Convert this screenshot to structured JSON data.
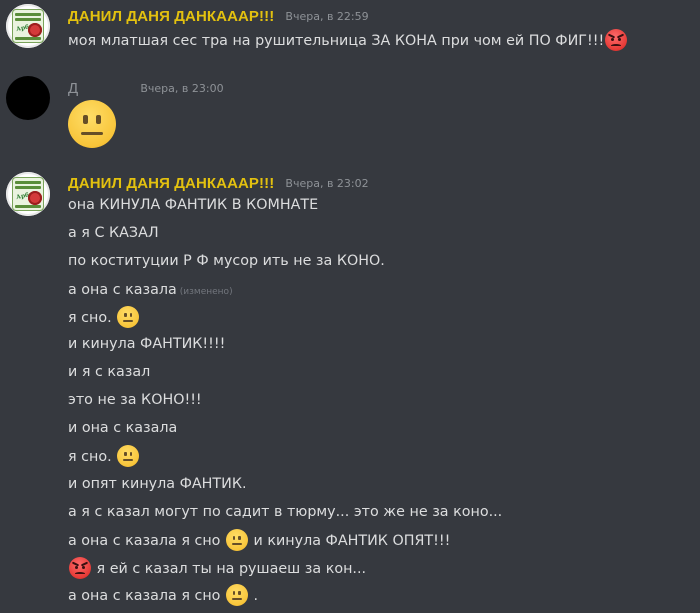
{
  "messages": [
    {
      "author": "ДАНИЛ ДАНЯ ДАНКАААР!!!",
      "timestamp": "Вчера, в 22:59",
      "avatar_text": "Арбуз",
      "lines": [
        {
          "text": "моя млатшая сес тра на рушительница ЗА КОНА при чом ей ПО ФИГ!!!",
          "emoji_after": "angry-face-icon"
        }
      ]
    },
    {
      "author": "Д",
      "timestamp": "Вчера, в 23:00",
      "big_emoji": "neutral-face-icon"
    },
    {
      "author": "ДАНИЛ ДАНЯ ДАНКАААР!!!",
      "timestamp": "Вчера, в 23:02",
      "lines": [
        {
          "text": "она КИНУЛА ФАНТИК В КОМНАТЕ"
        },
        {
          "text": "а я С КАЗАЛ"
        },
        {
          "text": "по коституции Р Ф мусор ить не за КОНО."
        },
        {
          "text": "а она с казала",
          "edited": "(изменено)"
        },
        {
          "text": "я сно.",
          "emoji_after": "neutral-face-icon"
        },
        {
          "text": "и кинула ФАНТИК!!!!"
        },
        {
          "text": "и я с казал"
        },
        {
          "text": "это не за КОНО!!!"
        },
        {
          "text": "и она с казала"
        },
        {
          "text": "я сно.",
          "emoji_after": "neutral-face-icon"
        },
        {
          "text": "и опят кинула ФАНТИК."
        },
        {
          "text": "а я с казал могут по садит в тюрму... это же не за коно..."
        },
        {
          "text": "а она с казала я сно",
          "emoji_after": "neutral-face-icon",
          "text_after": "и кинула ФАНТИК ОПЯТ!!!"
        },
        {
          "emoji_before": "angry-face-icon",
          "text": "я ей с казал ты на рушаеш за кон..."
        },
        {
          "text": "а она с казала я сно",
          "emoji_after": "neutral-face-icon",
          "text_after": "."
        }
      ]
    }
  ],
  "colors": {
    "background": "#36393f",
    "username": "#e3c10f",
    "timestamp": "#8e9297",
    "message_text": "#dcddde"
  }
}
